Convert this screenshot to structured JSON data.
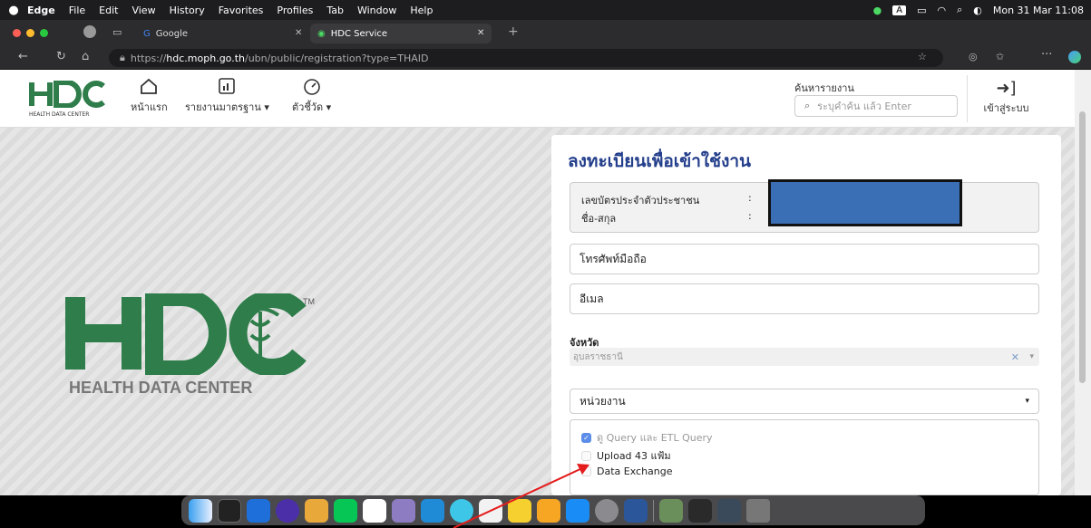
{
  "menubar": {
    "apple": "",
    "items": [
      "Edge",
      "File",
      "Edit",
      "View",
      "History",
      "Favorites",
      "Profiles",
      "Tab",
      "Window",
      "Help"
    ],
    "clock": "Mon 31 Mar 11:08",
    "input_badge": "A"
  },
  "tabs": [
    {
      "label": "Google"
    },
    {
      "label": "HDC Service",
      "active": true
    }
  ],
  "address": {
    "prefix": "https://",
    "host": "hdc.moph.go.th",
    "path": "/ubn/public/registration?type=THAID"
  },
  "nav": {
    "logo_text": "HEALTH DATA CENTER",
    "home": "หน้าแรก",
    "reports": "รายงานมาตรฐาน",
    "indicators": "ตัวชี้วัด",
    "search_label": "ค้นหารายงาน",
    "search_placeholder": "ระบุคำค้น แล้ว Enter",
    "login": "เข้าสู่ระบบ"
  },
  "biglogo": {
    "letters": "HDC",
    "caption": "HEALTH DATA CENTER",
    "tm": "TM"
  },
  "form": {
    "title": "ลงทะเบียนเพื่อเข้าใช้งาน",
    "id_label": "เลขบัตรประจำตัวประชาชน",
    "name_label": "ชื่อ-สกุล",
    "colon": ":",
    "phone": "โทรศัพท์มือถือ",
    "email": "อีเมล",
    "province_label": "จังหวัด",
    "province_value": "อุบลราชธานี",
    "unit_placeholder": "หน่วยงาน",
    "checks": [
      {
        "label": "ดู Query และ ETL Query",
        "checked": true
      },
      {
        "label": "Upload 43 แฟ้ม",
        "checked": false
      },
      {
        "label": "Data Exchange",
        "checked": false
      }
    ]
  },
  "colors": {
    "title": "#233e8b",
    "hdc_green": "#2e7d4a",
    "checkbox": "#5b8de8"
  }
}
